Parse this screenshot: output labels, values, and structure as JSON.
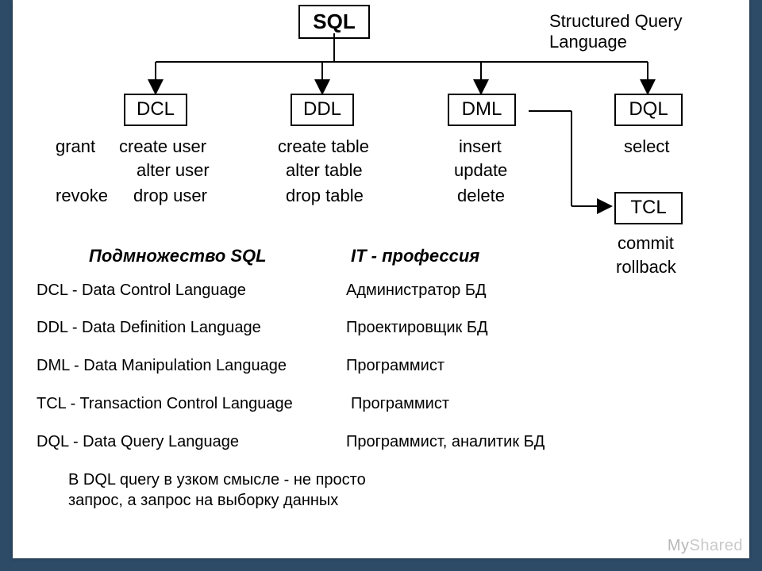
{
  "root": {
    "label": "SQL",
    "subtitle": "Structured Query Language"
  },
  "branches": {
    "dcl": {
      "label": "DCL",
      "cmds_col1": [
        "grant",
        "",
        "revoke"
      ],
      "cmds_col2": [
        "create user",
        "alter user",
        "drop user"
      ]
    },
    "ddl": {
      "label": "DDL",
      "cmds": [
        "create table",
        "alter table",
        "drop table"
      ]
    },
    "dml": {
      "label": "DML",
      "cmds": [
        "insert",
        "update",
        "delete"
      ]
    },
    "dql": {
      "label": "DQL",
      "cmds": [
        "select"
      ]
    },
    "tcl": {
      "label": "TCL",
      "cmds": [
        "commit",
        "rollback"
      ]
    }
  },
  "subset": {
    "heading": "Подмножество SQL",
    "items": [
      "DCL - Data Control Language",
      "DDL - Data Definition Language",
      "DML - Data Manipulation Language",
      "TCL - Transaction Control Language",
      "DQL - Data Query Language"
    ]
  },
  "profession": {
    "heading": "IT - профессия",
    "items": [
      "Администратор БД",
      "Проектировщик БД",
      "Программист",
      "Программист",
      "Программист, аналитик БД"
    ]
  },
  "note": {
    "line1": "В DQL query в узком смысле - не просто",
    "line2": "запрос, а запрос на выборку данных"
  },
  "watermark": {
    "left": "My",
    "right": "Shared"
  }
}
